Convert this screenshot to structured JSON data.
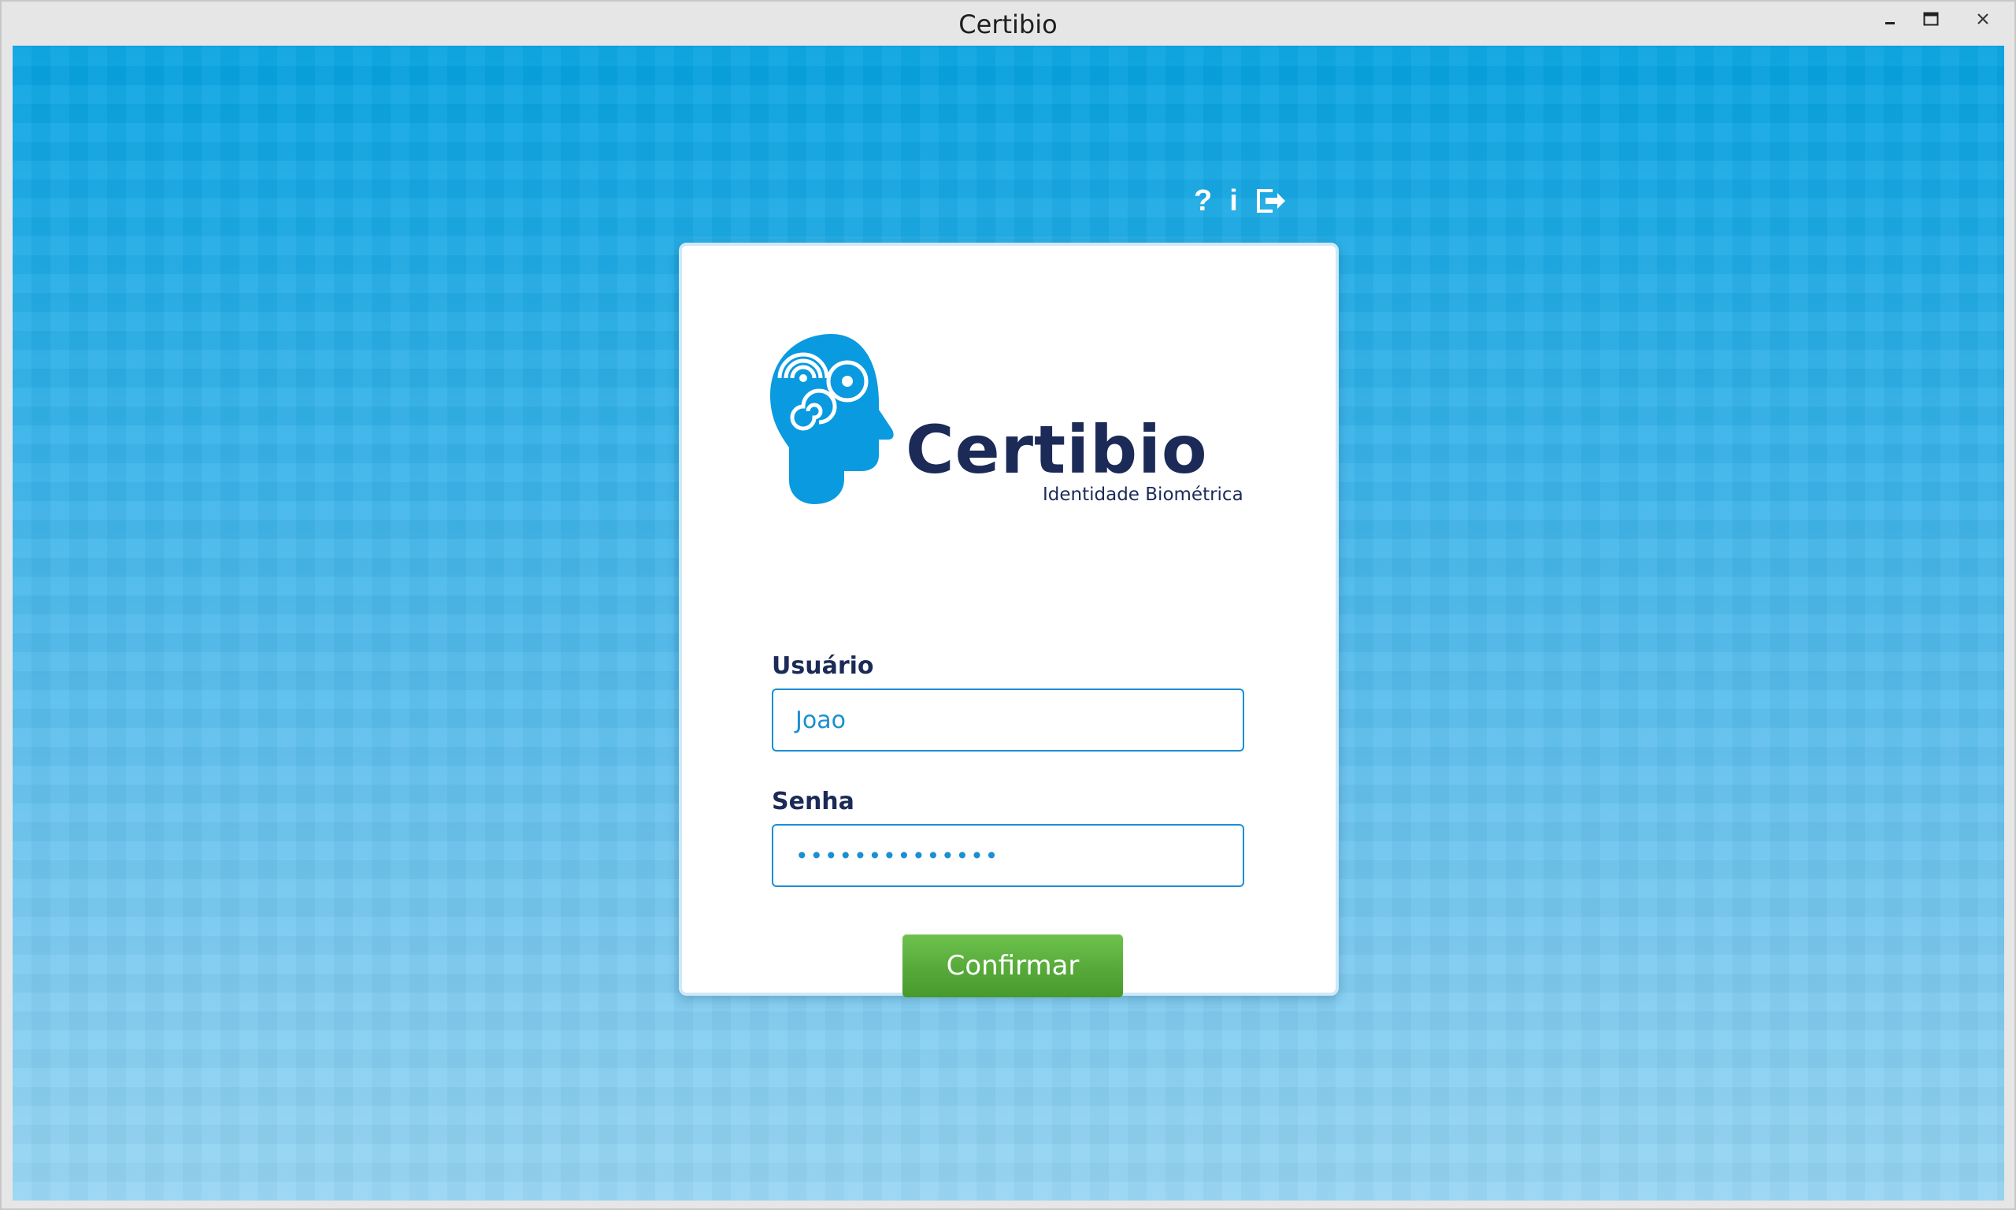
{
  "window": {
    "title": "Certibio",
    "controls": {
      "minimize_icon": "minimize-icon",
      "maximize_icon": "maximize-icon",
      "close_icon": "close-icon"
    }
  },
  "toolbar": {
    "help_label": "?",
    "info_label": "i",
    "exit_icon": "exit-icon"
  },
  "brand": {
    "name": "Certibio",
    "tagline": "Identidade Biométrica",
    "logo_icon": "head-biometric-icon"
  },
  "form": {
    "user_label": "Usuário",
    "user_value": "Joao",
    "password_label": "Senha",
    "password_value": "••••••••••••••",
    "confirm_label": "Confirmar"
  },
  "colors": {
    "background_top": "#05a3e1",
    "background_bottom": "#96d5f3",
    "brand_navy": "#1b2a57",
    "brand_blue": "#0a9ae0",
    "input_border": "#1d8ed6",
    "button_green": "#57aa39"
  }
}
